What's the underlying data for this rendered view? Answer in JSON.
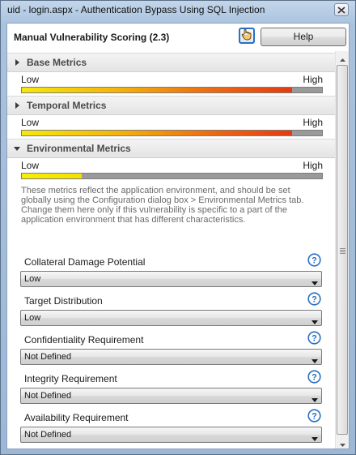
{
  "window": {
    "title": "uid - login.aspx - Authentication Bypass Using SQL Injection"
  },
  "header": {
    "title": "Manual Vulnerability Scoring (2.3)",
    "help_label": "Help"
  },
  "sections": [
    {
      "label": "Base Metrics",
      "expanded": false,
      "meter": {
        "low": "Low",
        "high": "High",
        "level": 0.9
      }
    },
    {
      "label": "Temporal Metrics",
      "expanded": false,
      "meter": {
        "low": "Low",
        "high": "High",
        "level": 0.9
      }
    },
    {
      "label": "Environmental Metrics",
      "expanded": true,
      "meter": {
        "low": "Low",
        "high": "High",
        "level": 0.2
      }
    }
  ],
  "environmental_note": "These metrics reflect the application environment, and should be set globally using the Configuration dialog box > Environmental Metrics tab. Change them here only if this vulnerability is specific to a part of the application environment that has different characteristics.",
  "fields": [
    {
      "label": "Collateral Damage Potential",
      "value": "Low"
    },
    {
      "label": "Target Distribution",
      "value": "Low"
    },
    {
      "label": "Confidentiality Requirement",
      "value": "Not Defined"
    },
    {
      "label": "Integrity Requirement",
      "value": "Not Defined"
    },
    {
      "label": "Availability Requirement",
      "value": "Not Defined"
    }
  ],
  "colors": {
    "accent": "#2a6fc4",
    "meter_track": "#9a9a9a",
    "meter_high": "#e63a10",
    "meter_low": "#f5e80a"
  },
  "icons": {
    "close": "close-icon",
    "hand": "hand-pointer-icon",
    "help": "question-circle-icon",
    "collapsed": "triangle-right-icon",
    "expanded": "triangle-down-icon",
    "dropdown": "chevron-down-icon"
  }
}
